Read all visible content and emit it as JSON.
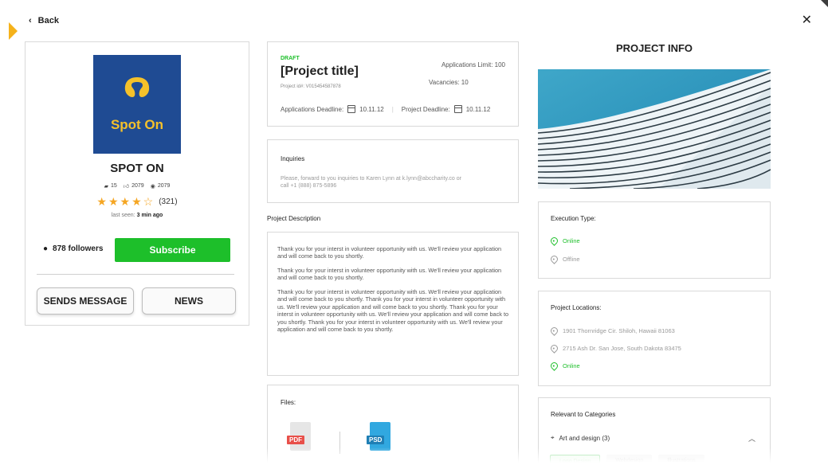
{
  "nav": {
    "back_label": "Back",
    "close_glyph": "✕"
  },
  "profile": {
    "logo_text": "Spot On",
    "name": "SPOT ON",
    "stats": {
      "projects": "15",
      "likes": "2079",
      "views": "2079"
    },
    "rating_count": "(321)",
    "last_seen_label": "last seen:",
    "last_seen_value": "3 min ago",
    "followers": "878 followers",
    "subscribe_label": "Subscribe",
    "message_label": "SENDS MESSAGE",
    "news_label": "NEWS"
  },
  "project": {
    "status": "DRAFT",
    "title": "[Project title]",
    "project_id": "Project id#: V015454587878",
    "applications_limit": "Applications Limit: 100",
    "vacancies": "Vacancies: 10",
    "applications_deadline_label": "Applications Deadline:",
    "applications_deadline": "10.11.12",
    "project_deadline_label": "Project Deadline:",
    "project_deadline": "10.11.12"
  },
  "inquiries": {
    "heading": "Inquiries",
    "text": "Please, forward to you inquiries to Karen Lynn at k.lynn@abccharity.co or call +1 (888) 875-5896"
  },
  "description": {
    "label": "Project Description",
    "paragraphs": [
      "Thank you for your interst in volunteer opportunity with us. We'll review your application and will come back to you shortly.",
      "Thank you for your interst in volunteer opportunity with us. We'll review your application and will come back to you shortly.",
      "Thank you for your interst in volunteer opportunity with us. We'll review your application and will come back to you shortly. Thank you for your interst in volunteer opportunity with us. We'll review your application and will come back to you shortly. Thank you for your interst in volunteer opportunity with us. We'll review your application and will come back to you shortly. Thank you for your interst in volunteer opportunity with us. We'll review your application and will come back to you shortly."
    ]
  },
  "files": {
    "heading": "Files:",
    "items": [
      {
        "type": "PDF",
        "color": "#e8504a"
      },
      {
        "type": "PSD",
        "color": "#31a8e0"
      }
    ]
  },
  "info": {
    "title": "PROJECT INFO",
    "execution_heading": "Execution Type:",
    "execution_online": "Online",
    "execution_offline": "Offline",
    "locations_heading": "Project Locations:",
    "location_1": "1901 Thornridge Cir. Shiloh, Hawaii 81063",
    "location_2": "2715 Ash Dr. San Jose, South Dakota 83475",
    "location_3": "Online",
    "categories_heading": "Relevant to Categories",
    "category": "Art and design (3)",
    "tags": [
      "Logo Design",
      "Webdesign",
      "Illustrations"
    ]
  },
  "colors": {
    "accent": "#1dbf2a",
    "brand_blue": "#1f4b93",
    "brand_yellow": "#f5c12a",
    "star": "#f5a623"
  }
}
